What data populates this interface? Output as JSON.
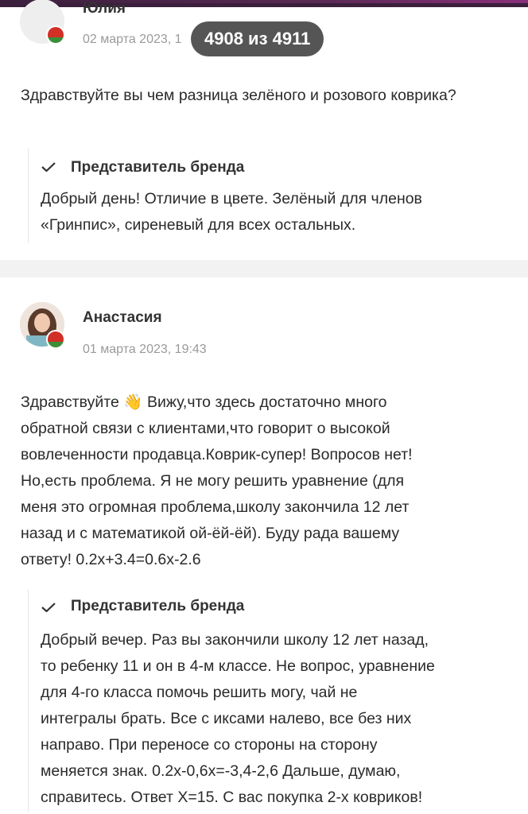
{
  "reviews": [
    {
      "author": "Юлия",
      "date": "02 марта 2023, 1",
      "text": "Здравствуйте вы чем разница зелёного и розового коврика?",
      "reply": {
        "title": "Представитель бренда",
        "text": "Добрый день! Отличие в цвете. Зелёный для членов «Гринпис», сиреневый для всех остальных."
      }
    },
    {
      "author": "Анастасия",
      "date": "01 марта 2023, 19:43",
      "text_lines": [
        "Здравствуйте",
        "👋",
        "Вижу,что здесь достаточно много",
        "обратной связи с клиентами,что говорит о высокой",
        "вовлеченности продавца.Коврик-супер! Вопросов нет!",
        "Но,есть проблема. Я не могу решить уравнение (для",
        "меня это огромная проблема,школу закончила 12 лет",
        "назад и с математикой ой-ёй-ёй). Буду рада вашему",
        "ответу! 0.2х+3.4=0.6х-2.6"
      ],
      "reply": {
        "title": "Представитель бренда",
        "text_lines": [
          "Добрый вечер. Раз вы закончили школу 12 лет назад,",
          "то ребенку 11 и он в 4-м классе. Не вопрос, уравнение",
          "для 4-го класса помочь решить могу, чай не",
          "интегралы брать. Все с иксами налево, все без них",
          "направо. При переносе со стороны на сторону",
          "меняется знак. 0.2х-0,6х=-3,4-2,6 Дальше, думаю,",
          "справитесь. Ответ Х=15. С вас покупка 2-х ковриков!"
        ]
      }
    }
  ],
  "counter": "4908 из 4911",
  "colors": {
    "accent_bar": "#3b1f3c",
    "flag_red": "#d22f27",
    "flag_green": "#3a8f3a",
    "counter_bg": "#464646"
  }
}
